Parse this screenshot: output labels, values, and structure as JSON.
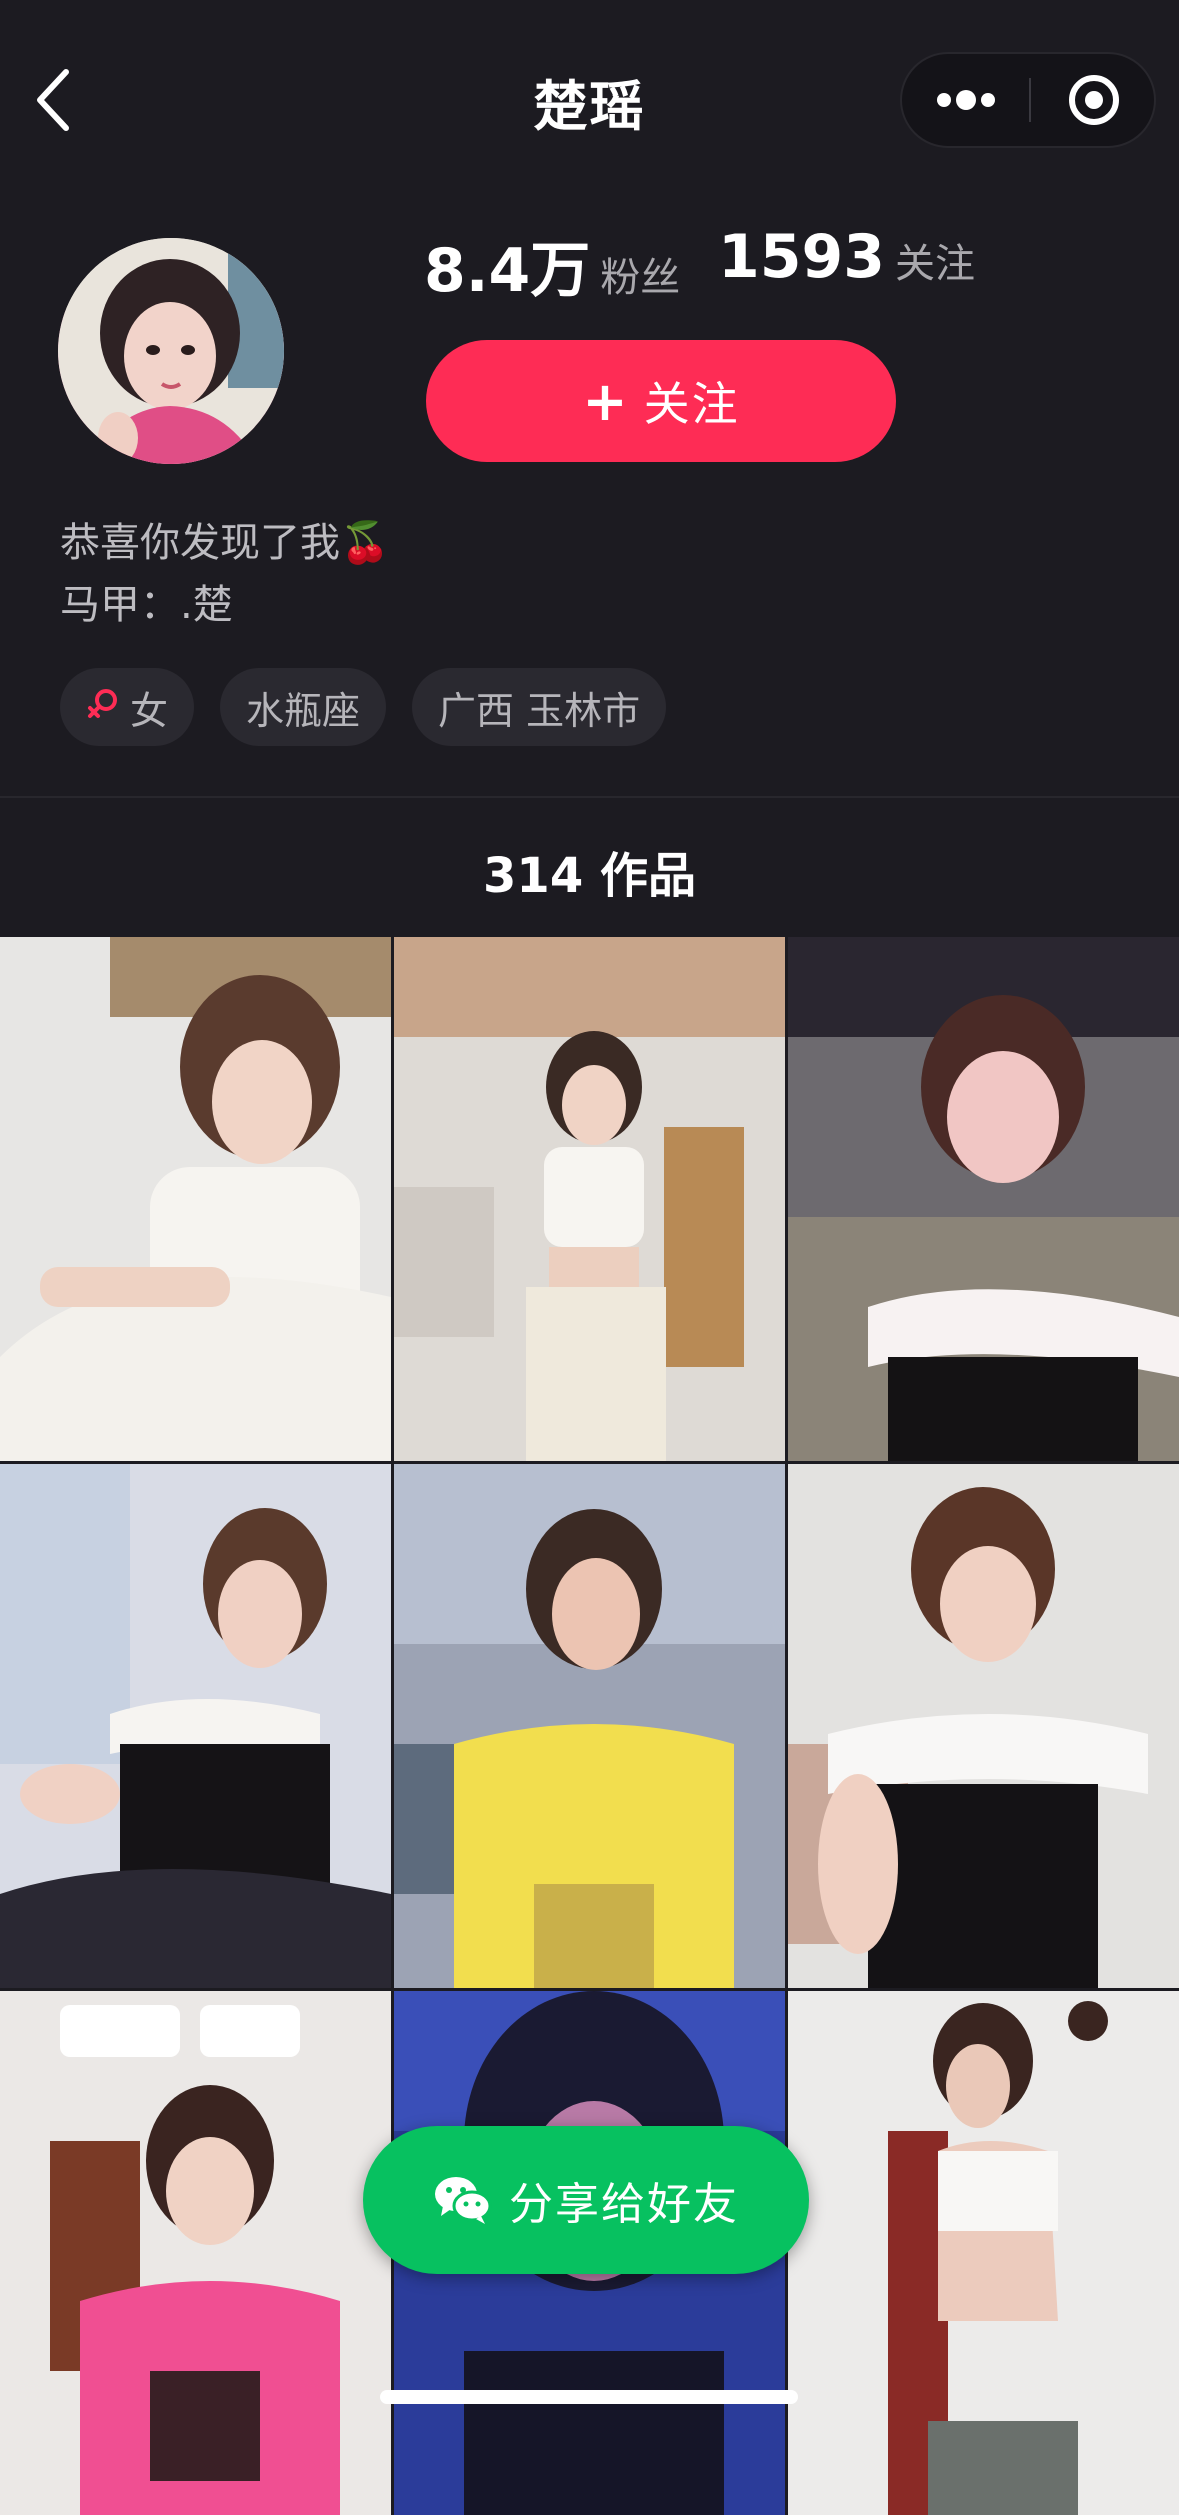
{
  "header": {
    "title": "楚瑶"
  },
  "profile": {
    "followers_count": "8.4万",
    "followers_label": "粉丝",
    "following_count": "1593",
    "following_label": "关注",
    "follow_button": "关注",
    "follow_button_icon": "+",
    "bio_line1": "恭喜你发现了我",
    "bio_emoji": "🍒",
    "bio_line2": "马甲：.楚",
    "tags": {
      "gender": "女",
      "zodiac": "水瓶座",
      "location": "广西 玉林市"
    }
  },
  "works": {
    "count_label": "314 作品",
    "thumbnails": [
      "video-1",
      "video-2",
      "video-3",
      "video-4",
      "video-5",
      "video-6",
      "video-7",
      "video-8",
      "video-9"
    ]
  },
  "share_button": {
    "label": "分享给好友",
    "icon": "wechat-icon"
  },
  "colors": {
    "background": "#1c1b21",
    "accent": "#fe2c55",
    "share_green": "#07c160"
  }
}
